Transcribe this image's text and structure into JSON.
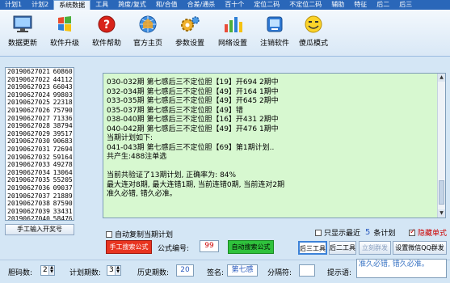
{
  "menu": {
    "tabs": [
      "计划1",
      "计划2",
      "系统数据",
      "工具",
      "跨度/复式",
      "和/合值",
      "合差/通杀",
      "百十个",
      "定位二码",
      "不定位二码",
      "辅助",
      "特征",
      "后二",
      "后三"
    ],
    "active_index": 2
  },
  "toolbar": {
    "buttons": [
      {
        "label": "数据更新",
        "icon": "monitor-icon"
      },
      {
        "label": "软件升级",
        "icon": "windows-flag-icon"
      },
      {
        "label": "软件帮助",
        "icon": "help-icon"
      },
      {
        "label": "官方主页",
        "icon": "home-globe-icon"
      },
      {
        "label": "参数设置",
        "icon": "gears-icon"
      },
      {
        "label": "网络设置",
        "icon": "bar-chart-icon"
      },
      {
        "label": "注销软件",
        "icon": "logout-icon"
      },
      {
        "label": "傻瓜模式",
        "icon": "smiley-icon"
      }
    ]
  },
  "left_list": [
    [
      "20190627021",
      "60860"
    ],
    [
      "20190627022",
      "44112"
    ],
    [
      "20190627023",
      "66043"
    ],
    [
      "20190627024",
      "99803"
    ],
    [
      "20190627025",
      "22318"
    ],
    [
      "20190627026",
      "75790"
    ],
    [
      "20190627027",
      "71336"
    ],
    [
      "20190627028",
      "38794"
    ],
    [
      "20190627029",
      "39517"
    ],
    [
      "20190627030",
      "90683"
    ],
    [
      "20190627031",
      "72694"
    ],
    [
      "20190627032",
      "59164"
    ],
    [
      "20190627033",
      "49278"
    ],
    [
      "20190627034",
      "13064"
    ],
    [
      "20190627035",
      "55205"
    ],
    [
      "20190627036",
      "09037"
    ],
    [
      "20190627037",
      "21889"
    ],
    [
      "20190627038",
      "87590"
    ],
    [
      "20190627039",
      "33431"
    ],
    [
      "20190627040",
      "58476"
    ]
  ],
  "manual_input_label": "手工输入开奖号",
  "main_lines": [
    "030-032期 第七感后三不定位胆【19】开694 2期中",
    "032-034期 第七感后三不定位胆【49】开164 1期中",
    "033-035期 第七感后三不定位胆【49】开645 2期中",
    "035-037期 第七感后三不定位胆【49】错",
    "038-040期 第七感后三不定位胆【16】开431 2期中",
    "040-042期 第七感后三不定位胆【49】开476 1期中",
    "当期计划如下:",
    "041-043期 第七感后三不定位胆【69】第1期计划..",
    "共产生:488注单选",
    "",
    "当前共验证了13期计划, 正确率为: 84%",
    "最大连对8期, 最大连错1期, 当前连错0期, 当前连对2期",
    "准久必错, 错久必准。"
  ],
  "checks": {
    "auto_copy": "自动复制当期计划",
    "show_recent": "只显示最近",
    "recent_count": "5",
    "recent_suffix": "条计划",
    "hide_single": "隐藏单式"
  },
  "buttons": {
    "manual_search": "手工搜索公式",
    "formula_no_label": "公式编号:",
    "formula_no": "99",
    "auto_search": "自动搜索公式",
    "rear3": "后三工具",
    "rear2": "后二工具",
    "copy_group": "立刻群发",
    "qq_group": "设置微信QQ群发"
  },
  "bottom": {
    "periods_label": "胆码数:",
    "periods_value": "2",
    "plan_label": "计划期数:",
    "plan_value": "3",
    "history_label": "历史期数:",
    "history_value": "20",
    "sign_label": "签名:",
    "sign_value": "第七感",
    "sep_label": "分隔符:",
    "sep_value": "",
    "hint_label": "提示语:",
    "hint_value": "准久必错, 错久必准。"
  }
}
